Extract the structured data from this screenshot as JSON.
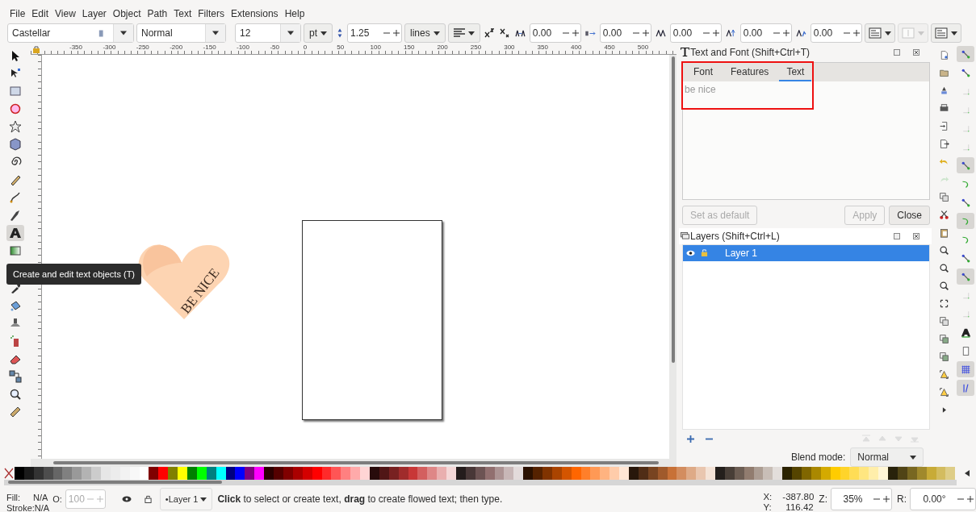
{
  "menu": [
    "File",
    "Edit",
    "View",
    "Layer",
    "Object",
    "Path",
    "Text",
    "Filters",
    "Extensions",
    "Help"
  ],
  "text_toolbar": {
    "font_family": "Castellar",
    "font_style": "Normal",
    "font_size": "12",
    "unit": "pt",
    "line_spacing": "1.25",
    "line_spacing_unit": "lines",
    "spacing_fields": [
      {
        "kind": "letter",
        "value": "0.00"
      },
      {
        "kind": "word",
        "value": "0.00"
      },
      {
        "kind": "kerning",
        "value": "0.00"
      },
      {
        "kind": "shift",
        "value": "0.00"
      },
      {
        "kind": "rotate",
        "value": "0.00"
      }
    ]
  },
  "toolbox": [
    {
      "kind": "arrow",
      "selected": false
    },
    {
      "kind": "node",
      "selected": false
    },
    {
      "kind": "rect",
      "selected": false
    },
    {
      "kind": "circle",
      "selected": false
    },
    {
      "kind": "star",
      "selected": false
    },
    {
      "kind": "cube",
      "selected": false
    },
    {
      "kind": "spiral",
      "selected": false
    },
    {
      "kind": "pencil",
      "selected": false
    },
    {
      "kind": "pen",
      "selected": false
    },
    {
      "kind": "calligraphy",
      "selected": false
    },
    {
      "kind": "text",
      "selected": true
    },
    {
      "kind": "gradient",
      "selected": false
    },
    {
      "kind": "dropper",
      "selected": false
    },
    {
      "kind": "bucket",
      "selected": false
    },
    {
      "kind": "tweak",
      "selected": false
    },
    {
      "kind": "spray",
      "selected": false
    },
    {
      "kind": "eraser",
      "selected": false
    },
    {
      "kind": "connector",
      "selected": false
    },
    {
      "kind": "zoom",
      "selected": false
    },
    {
      "kind": "measure",
      "selected": false
    }
  ],
  "tooltip": "Create and edit text objects (T)",
  "ruler_labels": [
    "-350",
    "-300",
    "-250",
    "-200",
    "-150",
    "-100",
    "-50",
    "0",
    "50",
    "100",
    "150",
    "200",
    "250",
    "300",
    "350",
    "400",
    "450",
    "500"
  ],
  "canvas": {
    "artwork_text": "BE NICE"
  },
  "text_font_dialog": {
    "title": "Text and Font (Shift+Ctrl+T)",
    "tabs": [
      {
        "label": "Font",
        "selected": false
      },
      {
        "label": "Features",
        "selected": false
      },
      {
        "label": "Text",
        "selected": true
      }
    ],
    "text": "be nice",
    "buttons": [
      {
        "label": "Set as default",
        "disabled": true
      },
      {
        "label": "Apply",
        "disabled": true
      },
      {
        "label": "Close",
        "disabled": false
      }
    ]
  },
  "layers_dialog": {
    "title": "Layers (Shift+Ctrl+L)",
    "layers": [
      {
        "name": "Layer 1",
        "selected": true
      }
    ],
    "blend_label": "Blend mode:",
    "blend_value": "Normal"
  },
  "commands_bar": [
    {
      "kind": "new"
    },
    {
      "kind": "open"
    },
    {
      "kind": "save"
    },
    {
      "kind": "print"
    },
    {
      "kind": "import"
    },
    {
      "kind": "export"
    },
    {
      "kind": "undo"
    },
    {
      "kind": "redo"
    },
    {
      "kind": "copy"
    },
    {
      "kind": "cut"
    },
    {
      "kind": "paste"
    },
    {
      "kind": "zoom"
    },
    {
      "kind": "zoom"
    },
    {
      "kind": "zoom"
    },
    {
      "kind": "fit"
    },
    {
      "kind": "copy"
    },
    {
      "kind": "clone"
    },
    {
      "kind": "clone"
    },
    {
      "kind": "group"
    },
    {
      "kind": "group"
    },
    {
      "kind": "more"
    }
  ],
  "snap_bar": [
    {
      "kind": "snap",
      "on": true
    },
    {
      "kind": "snap",
      "on": false
    },
    {
      "kind": "corner",
      "on": false
    },
    {
      "kind": "corner",
      "on": false
    },
    {
      "kind": "corner",
      "on": false
    },
    {
      "kind": "corner",
      "on": false
    },
    {
      "kind": "snap",
      "on": true
    },
    {
      "kind": "curve",
      "on": false
    },
    {
      "kind": "snap",
      "on": false
    },
    {
      "kind": "curve",
      "on": true
    },
    {
      "kind": "curve",
      "on": false
    },
    {
      "kind": "snap",
      "on": false
    },
    {
      "kind": "snap",
      "on": true
    },
    {
      "kind": "corner",
      "on": false
    },
    {
      "kind": "corner",
      "on": false
    },
    {
      "kind": "textbase",
      "on": false
    },
    {
      "kind": "page",
      "on": false
    },
    {
      "kind": "grid",
      "on": true
    },
    {
      "kind": "guide",
      "on": true
    }
  ],
  "palette": [
    {
      "color": "#000000"
    },
    {
      "color": "#1a1a1a"
    },
    {
      "color": "#333333"
    },
    {
      "color": "#4d4d4d"
    },
    {
      "color": "#666666"
    },
    {
      "color": "#808080"
    },
    {
      "color": "#999999"
    },
    {
      "color": "#b3b3b3"
    },
    {
      "color": "#cccccc"
    },
    {
      "color": "#e6e6e6"
    },
    {
      "color": "#ececec"
    },
    {
      "color": "#f2f2f2"
    },
    {
      "color": "#f8f8f8"
    },
    {
      "color": "#ffffff"
    },
    {
      "color": "#800000"
    },
    {
      "color": "#ff0000"
    },
    {
      "color": "#808000"
    },
    {
      "color": "#ffff00"
    },
    {
      "color": "#008000"
    },
    {
      "color": "#00ff00"
    },
    {
      "color": "#008080"
    },
    {
      "color": "#00ffff"
    },
    {
      "color": "#000080"
    },
    {
      "color": "#0000ff"
    },
    {
      "color": "#800080"
    },
    {
      "color": "#ff00ff"
    },
    {
      "color": "#2b0000"
    },
    {
      "color": "#550000"
    },
    {
      "color": "#800000"
    },
    {
      "color": "#aa0000"
    },
    {
      "color": "#d40000"
    },
    {
      "color": "#ff0000"
    },
    {
      "color": "#ff2a2a"
    },
    {
      "color": "#ff5555"
    },
    {
      "color": "#ff8080"
    },
    {
      "color": "#ffaaaa"
    },
    {
      "color": "#ffd5d5"
    },
    {
      "color": "#280b0b"
    },
    {
      "color": "#501616"
    },
    {
      "color": "#782121"
    },
    {
      "color": "#a02c2c"
    },
    {
      "color": "#c83737"
    },
    {
      "color": "#d35f5f"
    },
    {
      "color": "#de8787"
    },
    {
      "color": "#e9afaf"
    },
    {
      "color": "#f4d7d7"
    },
    {
      "color": "#241c1c"
    },
    {
      "color": "#483737"
    },
    {
      "color": "#6c5353"
    },
    {
      "color": "#916f6f"
    },
    {
      "color": "#ac9393"
    },
    {
      "color": "#c8b7b7"
    },
    {
      "color": "#e3dbdb"
    },
    {
      "color": "#2b1100"
    },
    {
      "color": "#552200"
    },
    {
      "color": "#803300"
    },
    {
      "color": "#aa4400"
    },
    {
      "color": "#d45500"
    },
    {
      "color": "#ff6600"
    },
    {
      "color": "#ff7f2a"
    },
    {
      "color": "#ff9955"
    },
    {
      "color": "#ffb380"
    },
    {
      "color": "#ffccaa"
    },
    {
      "color": "#ffe6d5"
    },
    {
      "color": "#28170b"
    },
    {
      "color": "#502d16"
    },
    {
      "color": "#784421"
    },
    {
      "color": "#a05a2c"
    },
    {
      "color": "#c87137"
    },
    {
      "color": "#d38d5f"
    },
    {
      "color": "#deaa87"
    },
    {
      "color": "#e9c6af"
    },
    {
      "color": "#f4e3d7"
    },
    {
      "color": "#241f1c"
    },
    {
      "color": "#483e37"
    },
    {
      "color": "#6c5d53"
    },
    {
      "color": "#917c6f"
    },
    {
      "color": "#ac9d93"
    },
    {
      "color": "#c8beb7"
    },
    {
      "color": "#e3dedb"
    },
    {
      "color": "#2b2200"
    },
    {
      "color": "#554400"
    },
    {
      "color": "#806600"
    },
    {
      "color": "#aa8800"
    },
    {
      "color": "#d4aa00"
    },
    {
      "color": "#ffcc00"
    },
    {
      "color": "#ffd42a"
    },
    {
      "color": "#ffdd55"
    },
    {
      "color": "#ffe680"
    },
    {
      "color": "#ffeeaa"
    },
    {
      "color": "#fff6d5"
    },
    {
      "color": "#28220b"
    },
    {
      "color": "#504416"
    },
    {
      "color": "#786721"
    },
    {
      "color": "#a0892c"
    },
    {
      "color": "#c8ab37"
    },
    {
      "color": "#d3bc5f"
    },
    {
      "color": "#decd87"
    }
  ],
  "status_bar": {
    "fill_label": "Fill:",
    "fill_value": "N/A",
    "stroke_label": "Stroke:",
    "stroke_value": "N/A",
    "opacity_label": "O:",
    "opacity_value": "100",
    "layer": "•Layer 1",
    "message": "**Click** to select or create text, **drag** to create flowed text; then type.",
    "x_label": "X:",
    "x_value": "-387.80",
    "y_label": "Y:",
    "y_value": "116.42",
    "zoom_label": "Z:",
    "zoom_value": "35%",
    "rotation_label": "R:",
    "rotation_value": "0.00°"
  }
}
